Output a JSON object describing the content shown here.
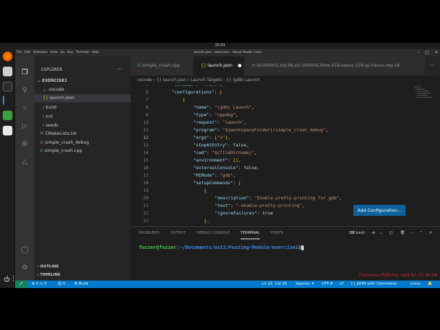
{
  "system": {
    "clock": "15:53"
  },
  "window": {
    "title": "launch.json - exercise1 - Visual Studio Code",
    "menu": [
      "File",
      "Edit",
      "Selection",
      "View",
      "Go",
      "Run",
      "Terminal",
      "Help"
    ]
  },
  "explorer": {
    "header": "EXPLORER",
    "root": "EXERCISE1",
    "items": [
      ".vscode",
      "launch.json",
      "build",
      "out",
      "seeds",
      "CMakeLists.txt",
      "simple_crash_debug",
      "simple_crash.cpp"
    ],
    "outline": "OUTLINE",
    "timeline": "TIMELINE"
  },
  "tabs": [
    "simple_crash.cpp",
    "launch.json",
    "id:000001,sig:06,src:000000,time:419,execs:129,op:havoc,rep:16"
  ],
  "breadcrumb": [
    ".vscode",
    "{} launch.json",
    "Launch Targets",
    "{} (gdb) Launch"
  ],
  "editor": {
    "line_numbers": [
      "5",
      "6",
      "7",
      "8",
      "9",
      "10",
      "11",
      "12",
      "13",
      "14",
      "15",
      "16",
      "17",
      "18",
      "19",
      "20",
      "21",
      "22",
      "23"
    ],
    "lines": [
      "\"version\": \"0.2.0\",",
      "\"configurations\": [",
      "{",
      "\"name\": \"(gdb) Launch\",",
      "\"type\": \"cppdbg\",",
      "\"request\": \"launch\",",
      "\"program\": \"${workspaceFolder}/simple_crash_debug\",",
      "\"args\": [\"<\"],",
      "\"stopAtEntry\": false,",
      "\"cwd\": \"${fileDirname}\",",
      "\"environment\": [],",
      "\"externalConsole\": false,",
      "\"MIMode\": \"gdb\",",
      "\"setupCommands\": [",
      "{",
      "\"description\": \"Enable pretty-printing for gdb\",",
      "\"text\": \"-enable-pretty-printing\",",
      "\"ignoreFailures\": true",
      "},"
    ],
    "add_config_button": "Add Configuration..."
  },
  "panel": {
    "tabs": [
      "PROBLEMS",
      "OUTPUT",
      "DEBUG CONSOLE",
      "TERMINAL",
      "PORTS"
    ],
    "shell": "bash",
    "prompt_user": "fuzzer@fuzzer",
    "prompt_path": ":~/Documents/ost2/Fuzzing-Module/exercise1",
    "prompt_symbol": "$",
    "watermark": "Francesco Pollicino, ost2.fyi, CC-BY-SA"
  },
  "status": {
    "errors": "0",
    "warnings": "0",
    "ports": "0",
    "build": "Build",
    "position": "Ln 12, Col 26",
    "spaces": "Spaces: 4",
    "encoding": "UTF-8",
    "eol": "LF",
    "language": "{} JSON with Comments",
    "os": "Linux"
  }
}
